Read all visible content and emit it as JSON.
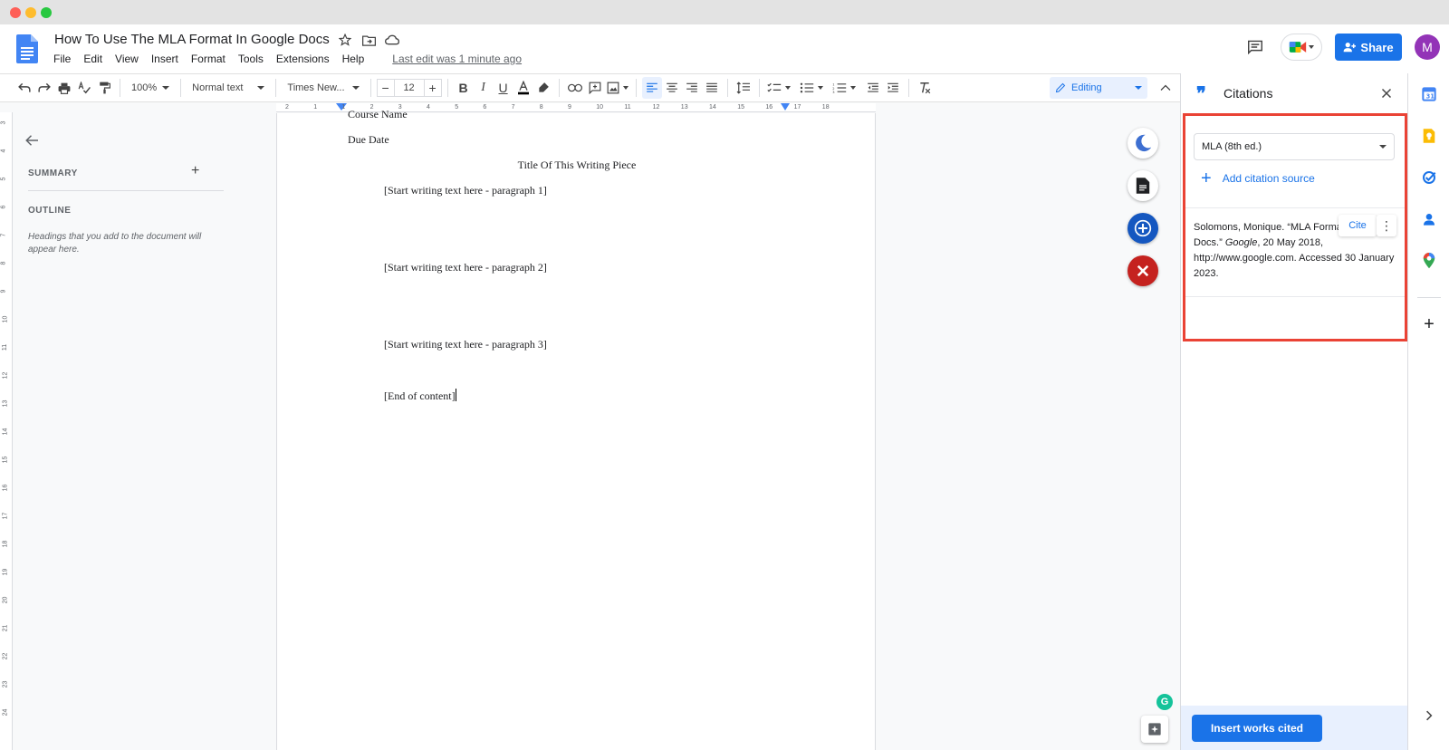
{
  "document": {
    "title": "How To Use The MLA Format In Google Docs",
    "last_edit": "Last edit was 1 minute ago"
  },
  "menu": {
    "items": [
      "File",
      "Edit",
      "View",
      "Insert",
      "Format",
      "Tools",
      "Extensions",
      "Help"
    ]
  },
  "header": {
    "share_label": "Share",
    "avatar_initial": "M"
  },
  "toolbar": {
    "zoom": "100%",
    "style": "Normal text",
    "font": "Times New...",
    "font_size": "12",
    "mode": "Editing"
  },
  "ruler": {
    "ticks": [
      "2",
      "1",
      "1",
      "2",
      "3",
      "4",
      "5",
      "6",
      "7",
      "8",
      "9",
      "10",
      "11",
      "12",
      "13",
      "14",
      "15",
      "16",
      "17",
      "18"
    ]
  },
  "vertical_ruler": {
    "ticks": [
      "3",
      "4",
      "5",
      "6",
      "7",
      "8",
      "9",
      "10",
      "11",
      "12",
      "13",
      "14",
      "15",
      "16",
      "17",
      "18",
      "19",
      "20",
      "21",
      "22",
      "23",
      "24"
    ]
  },
  "outline": {
    "summary_label": "SUMMARY",
    "outline_label": "OUTLINE",
    "hint": "Headings that you add to the document will appear here."
  },
  "page": {
    "course_name": "Course Name",
    "due_date": "Due Date",
    "heading": "Title Of This Writing Piece",
    "paragraphs": [
      "[Start writing text here - paragraph 1]",
      "[Start writing text here - paragraph 2]",
      "[Start writing text here - paragraph 3]",
      "[End of content]"
    ]
  },
  "citations": {
    "title": "Citations",
    "style": "MLA (8th ed.)",
    "add_source": "Add citation source",
    "entry": {
      "author": "Solomons, Monique. ",
      "title_part": "“MLA Format in Google Docs.” ",
      "container": "Google",
      "rest": ", 20 May 2018, http://www.google.com. Accessed 30 January 2023."
    },
    "cite_label": "Cite",
    "insert_label": "Insert works cited"
  },
  "colors": {
    "accent": "#1a73e8",
    "highlight_border": "#ea4335",
    "avatar_bg": "#9334b7",
    "close_fab": "#c5221f"
  }
}
